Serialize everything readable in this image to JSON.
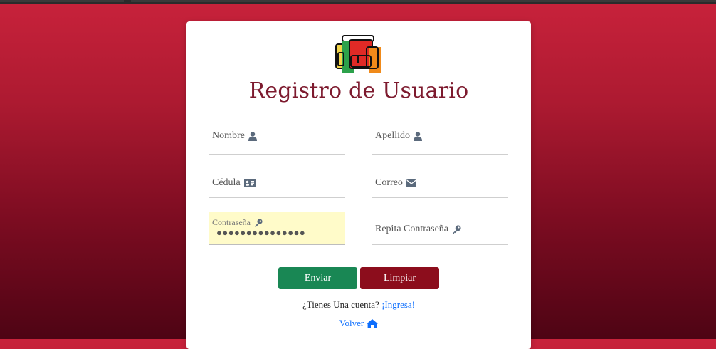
{
  "colors": {
    "accent": "#7d1a2e",
    "send": "#198754",
    "clear": "#8c0d1c",
    "link": "#0d6efd"
  },
  "header": {
    "title": "Registro de Usuario"
  },
  "fields": {
    "nombre": {
      "label": "Nombre",
      "icon": "user-icon"
    },
    "apellido": {
      "label": "Apellido",
      "icon": "user-icon"
    },
    "cedula": {
      "label": "Cédula",
      "icon": "id-card-icon"
    },
    "correo": {
      "label": "Correo",
      "icon": "envelope-icon"
    },
    "password": {
      "label": "Contraseña",
      "icon": "key-icon",
      "value": "●●●●●●●●●●●●●●●"
    },
    "repeat_password": {
      "label": "Repita Contraseña",
      "icon": "key-icon"
    }
  },
  "buttons": {
    "send_label": "Enviar",
    "clear_label": "Limpiar"
  },
  "footer": {
    "account_prompt": "¿Tienes Una cuenta?",
    "login_link": "¡Ingresa!",
    "back_link": "Volver",
    "back_icon": "home-icon"
  }
}
